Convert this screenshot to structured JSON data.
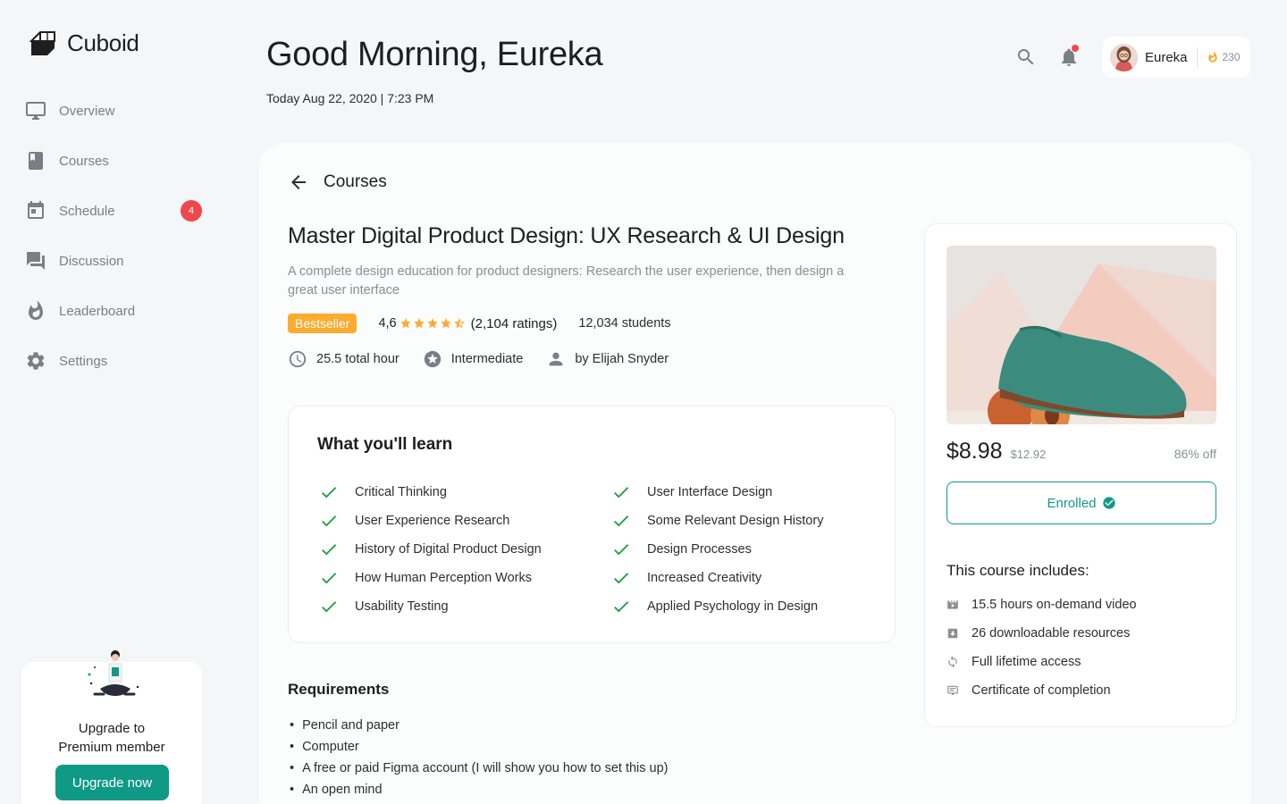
{
  "brand": {
    "name": "Cuboid"
  },
  "sidebar": {
    "items": [
      {
        "label": "Overview",
        "icon": "monitor-icon"
      },
      {
        "label": "Courses",
        "icon": "book-icon"
      },
      {
        "label": "Schedule",
        "icon": "calendar-icon",
        "badge": "4"
      },
      {
        "label": "Discussion",
        "icon": "chat-icon"
      },
      {
        "label": "Leaderboard",
        "icon": "flame-icon"
      },
      {
        "label": "Settings",
        "icon": "gear-icon"
      }
    ],
    "premium": {
      "line1": "Upgrade to",
      "line2": "Premium member",
      "button": "Upgrade now"
    }
  },
  "header": {
    "greeting": "Good Morning, Eureka",
    "date": "Today Aug 22, 2020 | 7:23 PM",
    "user": {
      "name": "Eureka",
      "points": "230"
    }
  },
  "course": {
    "breadcrumb": "Courses",
    "title": "Master Digital Product Design: UX Research & UI Design",
    "description": "A complete design education for product designers: Research the user experience, then design a great user interface",
    "badge": "Bestseller",
    "rating": "4,6",
    "rating_value": 4.6,
    "rating_max": 5,
    "ratings_count": "(2,104 ratings)",
    "students": "12,034 students",
    "duration": "25.5 total hour",
    "level": "Intermediate",
    "author": "by Elijah Snyder"
  },
  "learn": {
    "title": "What you'll learn",
    "col1": [
      "Critical Thinking",
      "User Experience Research",
      "History of Digital Product Design",
      "How Human Perception Works",
      "Usability Testing"
    ],
    "col2": [
      "User Interface Design",
      "Some Relevant Design History",
      "Design Processes",
      "Increased Creativity",
      "Applied Psychology in Design"
    ]
  },
  "requirements": {
    "title": "Requirements",
    "items": [
      "Pencil and paper",
      "Computer",
      "A free or paid Figma account (I will show you how to set this up)",
      "An open mind"
    ]
  },
  "purchase": {
    "price": "$8.98",
    "old_price": "$12.92",
    "discount": "86% off",
    "button": "Enrolled",
    "includes_title": "This course includes:",
    "includes": [
      {
        "label": "15.5 hours on-demand video",
        "icon": "video-icon"
      },
      {
        "label": "26 downloadable resources",
        "icon": "download-icon"
      },
      {
        "label": "Full lifetime access",
        "icon": "refresh-icon"
      },
      {
        "label": "Certificate of completion",
        "icon": "certificate-icon"
      }
    ]
  },
  "colors": {
    "accent": "#0f9a86",
    "badge": "#fbab2e",
    "notification": "#f0474d",
    "check": "#1a9c3e",
    "star": "#fbab2e"
  }
}
